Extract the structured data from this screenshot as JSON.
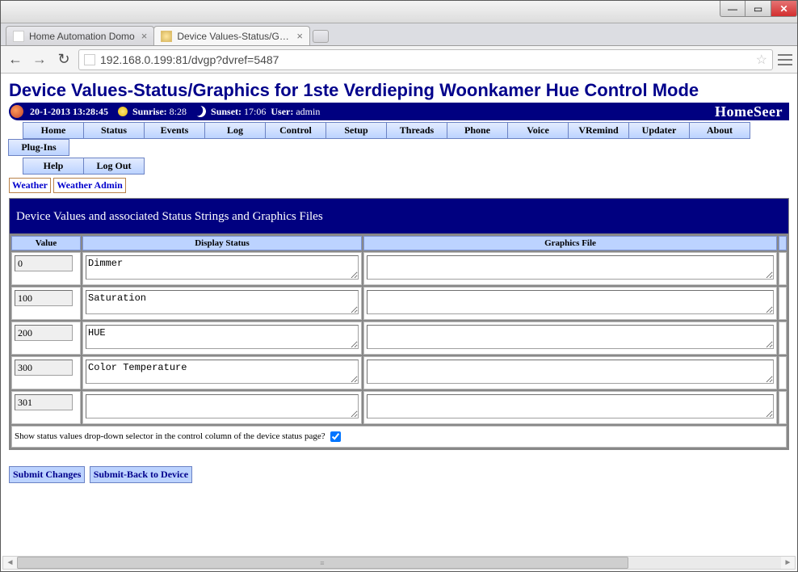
{
  "browser": {
    "tabs": [
      {
        "title": "Home Automation Domo",
        "active": false
      },
      {
        "title": "Device Values-Status/Grap",
        "active": true
      }
    ],
    "url": "192.168.0.199:81/dvgp?dvref=5487"
  },
  "page": {
    "title": "Device Values-Status/Graphics for 1ste Verdieping Woonkamer Hue Control Mode"
  },
  "statusbar": {
    "datetime": "20-1-2013 13:28:45",
    "sunrise_label": "Sunrise:",
    "sunrise_value": "8:28",
    "sunset_label": "Sunset:",
    "sunset_value": "17:06",
    "user_label": "User:",
    "user_value": "admin",
    "brand": "HomeSeer"
  },
  "nav": {
    "row1": [
      "Home",
      "Status",
      "Events",
      "Log",
      "Control",
      "Setup",
      "Threads",
      "Phone",
      "Voice",
      "VRemind",
      "Updater",
      "About",
      "Plug-Ins"
    ],
    "row2": [
      "Help",
      "Log Out"
    ],
    "subtabs": [
      "Weather",
      "Weather Admin"
    ]
  },
  "section_title": "Device Values and associated Status Strings and Graphics Files",
  "table": {
    "headers": {
      "value": "Value",
      "status": "Display Status",
      "graphics": "Graphics File"
    },
    "rows": [
      {
        "value": "0",
        "status": "Dimmer",
        "graphics": ""
      },
      {
        "value": "100",
        "status": "Saturation",
        "graphics": ""
      },
      {
        "value": "200",
        "status": "HUE",
        "graphics": ""
      },
      {
        "value": "300",
        "status": "Color Temperature",
        "graphics": ""
      },
      {
        "value": "301",
        "status": "",
        "graphics": ""
      }
    ],
    "footer_label": "Show status values drop-down selector in the control column of the device status page?",
    "footer_checked": true
  },
  "actions": {
    "submit": "Submit Changes",
    "submit_back": "Submit-Back to Device"
  }
}
